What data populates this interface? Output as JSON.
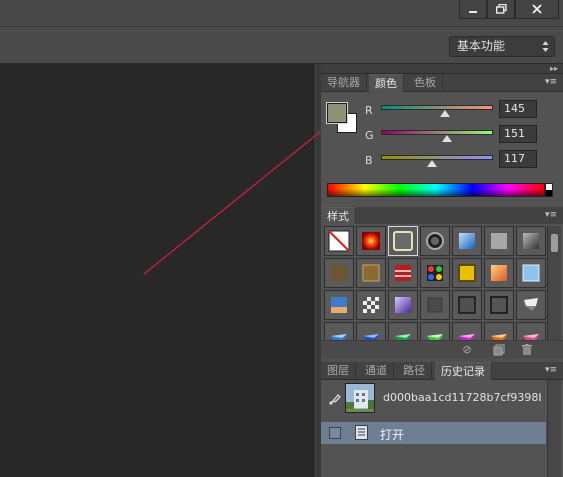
{
  "window": {
    "buttons": [
      "minimize",
      "restore",
      "close"
    ],
    "icons": [
      "minimize-icon",
      "restore-icon",
      "close-icon"
    ]
  },
  "options_bar": {
    "workspace_value": "基本功能"
  },
  "color_panel": {
    "tabs": [
      "导航器",
      "颜色",
      "色板"
    ],
    "active_tab": "颜色",
    "foreground_color": "#919175",
    "background_color": "#ffffff",
    "channels": [
      {
        "label": "R",
        "value": "145",
        "fraction": 0.569,
        "gradient": "linear-gradient(to right, #009175, #ff9175)"
      },
      {
        "label": "G",
        "value": "151",
        "fraction": 0.592,
        "gradient": "linear-gradient(to right, #910075, #91ff75)"
      },
      {
        "label": "B",
        "value": "117",
        "fraction": 0.459,
        "gradient": "linear-gradient(to right, #919100, #9191ff)"
      }
    ]
  },
  "styles_panel": {
    "tabs": [
      "样式"
    ],
    "active_tab": "样式",
    "selected_index": 2,
    "swatches": [
      "none",
      "red-burst",
      "outline-gray",
      "black-ring",
      "blue-glass",
      "gray-flat",
      "dark-gray",
      "brown-flat",
      "brown-bevel",
      "red-stripes",
      "rainbow-dots",
      "yellow-bevel",
      "orange-gradient",
      "light-blue",
      "sky-scene",
      "checker-pattern",
      "purple-glass",
      "dark-square",
      "dark-outline",
      "dark-outline-2",
      "white-flag",
      "blue-shard",
      "blue-shard-2",
      "green-shard",
      "green-shard-2",
      "magenta-shard",
      "orange-shard",
      "pink-shard"
    ],
    "footer_icons": [
      "clear-style-icon",
      "new-style-icon",
      "delete-style-icon"
    ]
  },
  "history_panel": {
    "tabs": [
      "图层",
      "通道",
      "路径",
      "历史记录"
    ],
    "active_tab": "历史记录",
    "snapshot_name": "d000baa1cd11728b7cf9398b...",
    "states": [
      {
        "label": "打开",
        "selected": true
      }
    ]
  },
  "accent_colors": {
    "annotation_line": "#c8203a",
    "history_selection": "#6f7f93"
  }
}
